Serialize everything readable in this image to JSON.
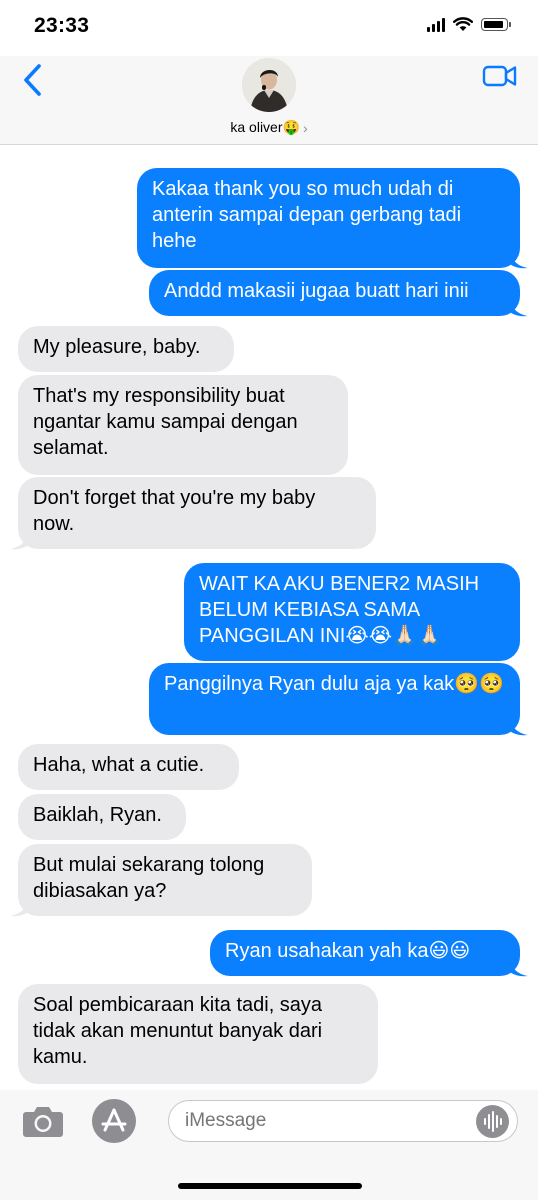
{
  "status_bar": {
    "time": "23:33",
    "battery_level": 1.0
  },
  "header": {
    "contact_name": "ka oliver🤑",
    "chevron": "›",
    "back_icon": "chevron-left-icon",
    "video_icon": "video-camera-icon",
    "accent_color": "#0a7aff"
  },
  "messages": [
    {
      "from": "me",
      "text": "Kakaa thank you so much udah di anterin sampai depan gerbang tadi hehe"
    },
    {
      "from": "me",
      "text": "Anddd makasii jugaa buatt hari inii"
    },
    {
      "from": "them",
      "text": "My pleasure, baby."
    },
    {
      "from": "them",
      "text": "That's my responsibility buat ngantar kamu sampai dengan selamat."
    },
    {
      "from": "them",
      "text": "Don't forget that you're my baby now."
    },
    {
      "from": "me",
      "text": "WAIT KA AKU BENER2 MASIH BELUM KEBIASA SAMA PANGGILAN INI😭😭🙏🏻🙏🏻"
    },
    {
      "from": "me",
      "text": "Panggilnya Ryan dulu aja ya kak🥺🥺"
    },
    {
      "from": "them",
      "text": "Haha, what a cutie."
    },
    {
      "from": "them",
      "text": "Baiklah, Ryan."
    },
    {
      "from": "them",
      "text": "But mulai sekarang tolong dibiasakan ya?"
    },
    {
      "from": "me",
      "text": "Ryan usahakan yah ka😃😃"
    },
    {
      "from": "them",
      "text": "Soal pembicaraan kita tadi, saya tidak akan menuntut banyak dari kamu."
    }
  ],
  "colors": {
    "sent_bubble": "#0a80fe",
    "received_bubble": "#e9e9eb"
  },
  "input_bar": {
    "placeholder": "iMessage",
    "camera_icon": "camera-icon",
    "appstore_icon": "app-store-icon",
    "voice_icon": "audio-waveform-icon"
  }
}
